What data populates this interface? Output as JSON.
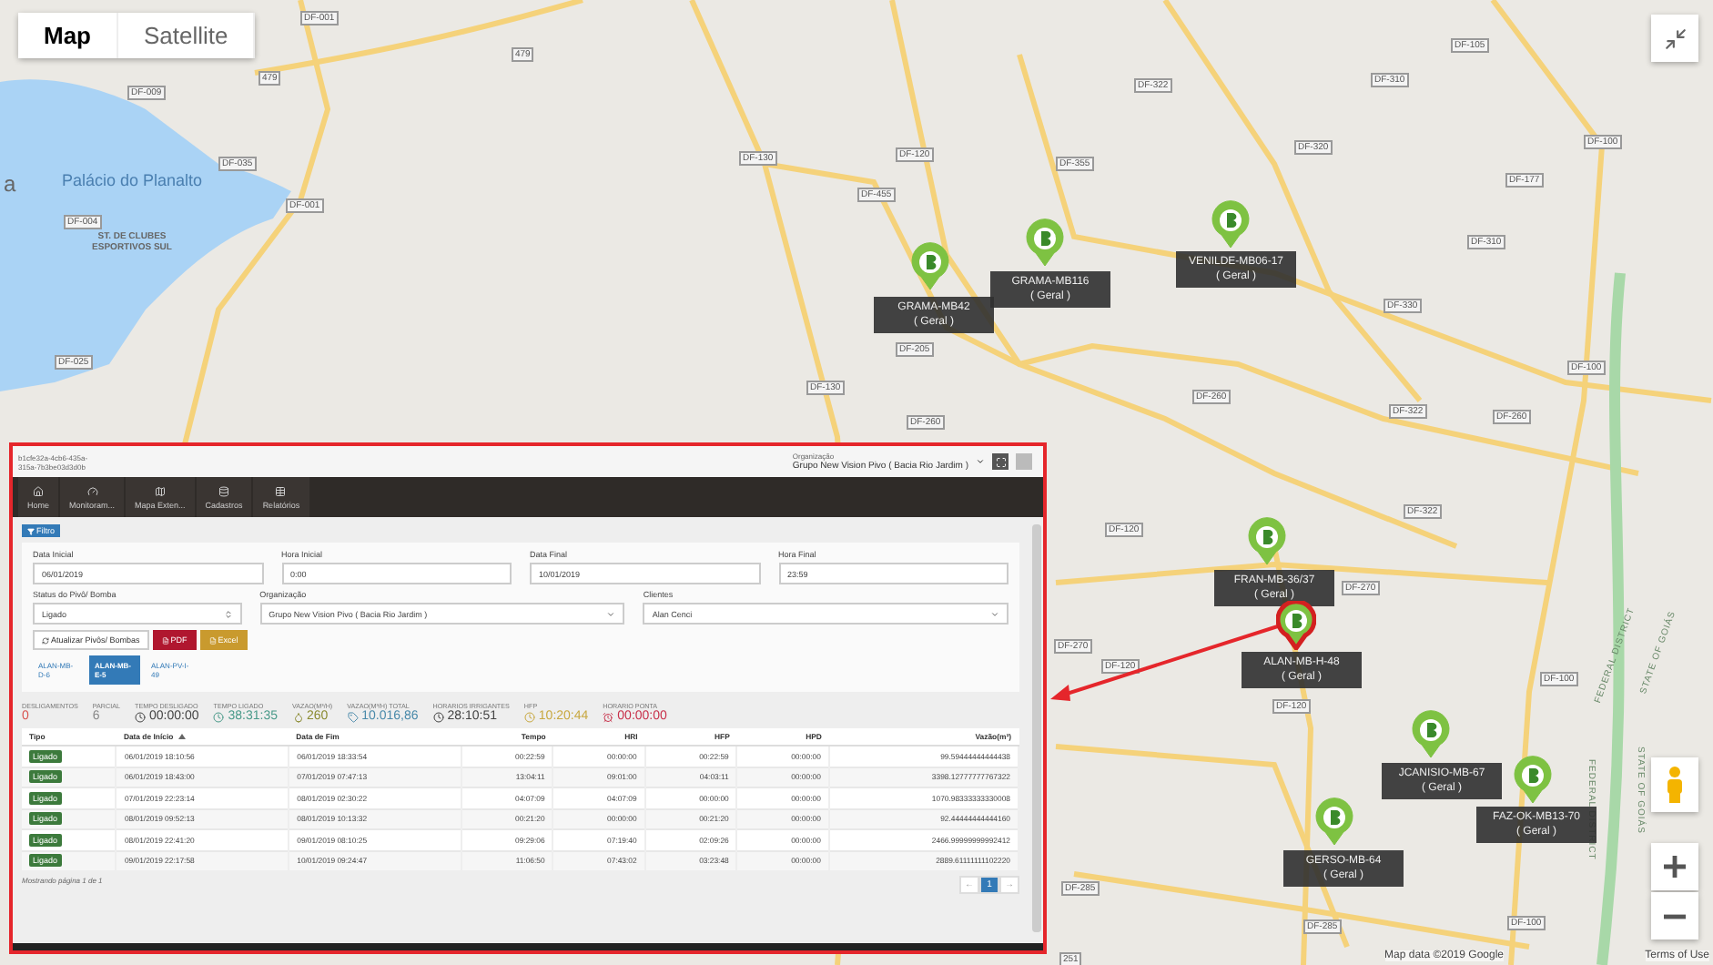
{
  "map": {
    "type_buttons": [
      {
        "label": "Map",
        "selected": true
      },
      {
        "label": "Satellite",
        "selected": false
      }
    ],
    "place_labels": [
      {
        "label": "a",
        "kind": "city"
      },
      {
        "label": "Palácio do Planalto",
        "kind": "poi"
      },
      {
        "label": "ST. DE CLUBES ESPORTIVOS SUL",
        "kind": "area"
      }
    ],
    "road_labels": [
      "DF-001",
      "479",
      "479",
      "DF-009",
      "DF-035",
      "DF-001",
      "DF-004",
      "DF-025",
      "DF-130",
      "DF-130",
      "DF-120",
      "DF-455",
      "DF-355",
      "DF-322",
      "DF-320",
      "DF-310",
      "DF-105",
      "DF-100",
      "DF-177",
      "DF-310",
      "DF-330",
      "DF-100",
      "DF-205",
      "DF-260",
      "DF-260",
      "DF-322",
      "DF-260",
      "DF-120",
      "DF-322",
      "DF-270",
      "DF-270",
      "DF-120",
      "DF-120",
      "DF-100",
      "DF-285",
      "DF-285",
      "DF-100",
      "251"
    ],
    "region_labels": [
      "FEDERAL DISTRICT",
      "STATE OF GOIÁS",
      "FEDERAL DISTRICT",
      "STATE OF GOIÁS"
    ],
    "markers": [
      {
        "name": "GRAMA-MB42",
        "group": "( Geral )",
        "selected": false
      },
      {
        "name": "GRAMA-MB116",
        "group": "( Geral )",
        "selected": false
      },
      {
        "name": "VENILDE-MB06-17",
        "group": "( Geral )",
        "selected": false
      },
      {
        "name": "FRAN-MB-36/37",
        "group": "( Geral )",
        "selected": false
      },
      {
        "name": "ALAN-MB-H-48",
        "group": "( Geral )",
        "selected": true
      },
      {
        "name": "JCANISIO-MB-67",
        "group": "( Geral )",
        "selected": false
      },
      {
        "name": "FAZ-OK-MB13-70",
        "group": "( Geral )",
        "selected": false
      },
      {
        "name": "GERSO-MB-64",
        "group": "( Geral )",
        "selected": false
      }
    ],
    "attribution": "Map data ©2019 Google",
    "terms": "Terms of Use"
  },
  "inset": {
    "session_lines": [
      "b1cfe32a-4cb6-435a-",
      "315a-7b3be03d3d0b"
    ],
    "org_caption": "Organização",
    "org_value": "Grupo New Vision Pivo ( Bacia Rio Jardim )",
    "nav": [
      "Home",
      "Monitoram...",
      "Mapa Exten...",
      "Cadastros",
      "Relatórios"
    ],
    "filter_button": "Filtro",
    "fields": [
      {
        "label": "Data Inicial",
        "value": "06/01/2019",
        "kind": "text"
      },
      {
        "label": "Hora Inicial",
        "value": "0:00",
        "kind": "text"
      },
      {
        "label": "Data Final",
        "value": "10/01/2019",
        "kind": "text"
      },
      {
        "label": "Hora Final",
        "value": "23:59",
        "kind": "text"
      },
      {
        "label": "Status do Pivô/ Bomba",
        "value": "Ligado",
        "kind": "spinner"
      },
      {
        "label": "Organização",
        "value": "Grupo New Vision Pivo ( Bacia Rio Jardim )",
        "kind": "select"
      },
      {
        "label": "Clientes",
        "value": "Alan Cenci",
        "kind": "select"
      }
    ],
    "actions": [
      {
        "label": "Atualizar Pivôs/ Bombas",
        "kind": "refresh"
      },
      {
        "label": "PDF",
        "kind": "pdf"
      },
      {
        "label": "Excel",
        "kind": "excel"
      }
    ],
    "device_tabs": [
      {
        "label": "ALAN-MB-D-6",
        "selected": false
      },
      {
        "label": "ALAN-MB-E-5",
        "selected": true
      },
      {
        "label": "ALAN-PV-I-49",
        "selected": false
      }
    ],
    "stats": [
      {
        "label": "DESLIGAMENTOS",
        "value": "0",
        "kind": "plain",
        "color": "#d9534f"
      },
      {
        "label": "PARCIAL",
        "value": "6",
        "kind": "plain",
        "color": "#888888"
      },
      {
        "label": "TEMPO DESLIGADO",
        "value": "00:00:00",
        "kind": "clock",
        "color": "#444444"
      },
      {
        "label": "TEMPO LIGADO",
        "value": "38:31:35",
        "kind": "clock",
        "color": "#4a9a8a"
      },
      {
        "label": "VAZAO(M³/H)",
        "value": "260",
        "kind": "drop",
        "color": "#8a8a30"
      },
      {
        "label": "VAZAO(M³/H) TOTAL",
        "value": "10.016,86",
        "kind": "tag",
        "color": "#4a8aaa"
      },
      {
        "label": "HORARIOS IRRIGANTES",
        "value": "28:10:51",
        "kind": "clock",
        "color": "#444444"
      },
      {
        "label": "HFP",
        "value": "10:20:44",
        "kind": "clock",
        "color": "#c8a840"
      },
      {
        "label": "HORARIO PONTA",
        "value": "00:00:00",
        "kind": "alarm",
        "color": "#c8304a"
      }
    ],
    "table": {
      "columns": [
        "Tipo",
        "Data de Início",
        "Data de Fim",
        "Tempo",
        "HRI",
        "HFP",
        "HPD",
        "Vazão(m³)"
      ],
      "rows": [
        [
          "Ligado",
          "06/01/2019 18:10:56",
          "06/01/2019 18:33:54",
          "00:22:59",
          "00:00:00",
          "00:22:59",
          "00:00:00",
          "99.59444444444438"
        ],
        [
          "Ligado",
          "06/01/2019 18:43:00",
          "07/01/2019 07:47:13",
          "13:04:11",
          "09:01:00",
          "04:03:11",
          "00:00:00",
          "3398.12777777767322"
        ],
        [
          "Ligado",
          "07/01/2019 22:23:14",
          "08/01/2019 02:30:22",
          "04:07:09",
          "04:07:09",
          "00:00:00",
          "00:00:00",
          "1070.98333333330008"
        ],
        [
          "Ligado",
          "08/01/2019 09:52:13",
          "08/01/2019 10:13:32",
          "00:21:20",
          "00:00:00",
          "00:21:20",
          "00:00:00",
          "92.44444444444160"
        ],
        [
          "Ligado",
          "08/01/2019 22:41:20",
          "09/01/2019 08:10:25",
          "09:29:06",
          "07:19:40",
          "02:09:26",
          "00:00:00",
          "2466.99999999992412"
        ],
        [
          "Ligado",
          "09/01/2019 22:17:58",
          "10/01/2019 09:24:47",
          "11:06:50",
          "07:43:02",
          "03:23:48",
          "00:00:00",
          "2889.61111111102220"
        ]
      ]
    },
    "footer": "Mostrando página 1 de 1",
    "pagination": [
      {
        "label": "←",
        "selected": false
      },
      {
        "label": "1",
        "selected": true
      },
      {
        "label": "→",
        "selected": false
      }
    ]
  }
}
